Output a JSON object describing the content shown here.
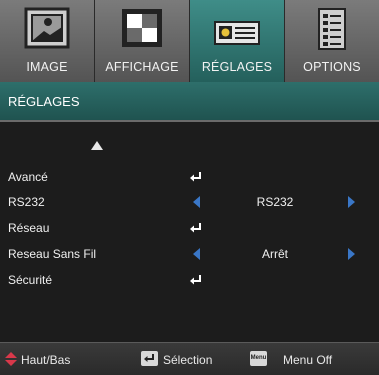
{
  "tabs": [
    {
      "label": "IMAGE",
      "icon": "image-icon",
      "active": false
    },
    {
      "label": "AFFICHAGE",
      "icon": "display-icon",
      "active": false
    },
    {
      "label": "RÉGLAGES",
      "icon": "projector-icon",
      "active": true
    },
    {
      "label": "OPTIONS",
      "icon": "options-list-icon",
      "active": false
    }
  ],
  "header": {
    "title": "RÉGLAGES"
  },
  "menu": {
    "items": [
      {
        "label": "Avancé",
        "control": "enter-icon"
      },
      {
        "label": "RS232",
        "control": "selector",
        "value": "RS232"
      },
      {
        "label": "Réseau",
        "control": "enter-icon"
      },
      {
        "label": "Reseau Sans Fil",
        "control": "selector",
        "value": "Arrêt"
      },
      {
        "label": "Sécurité",
        "control": "enter-icon"
      }
    ]
  },
  "footer": {
    "updown_label": "Haut/Bas",
    "select_label": "Sélection",
    "menu_key": "Menu",
    "menu_label": "Menu Off"
  },
  "colors": {
    "active_tab": "#2f7a75",
    "arrow": "#3a77c7",
    "updown": "#d8384a"
  }
}
